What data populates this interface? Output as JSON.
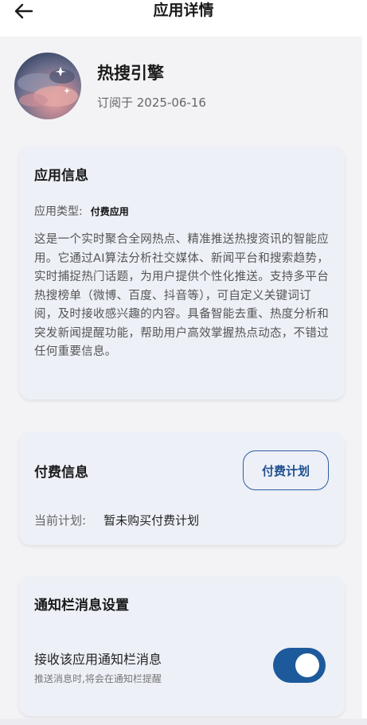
{
  "header": {
    "title": "应用详情"
  },
  "app": {
    "name": "热搜引擎",
    "subscribed": "订阅于 2025-06-16"
  },
  "info_card": {
    "title": "应用信息",
    "type_label": "应用类型:",
    "type_value": "付费应用",
    "description": "这是一个实时聚合全网热点、精准推送热搜资讯的智能应用。它通过AI算法分析社交媒体、新闻平台和搜索趋势，实时捕捉热门话题，为用户提供个性化推送。支持多平台热搜榜单（微博、百度、抖音等），可自定义关键词订阅，及时接收感兴趣的内容。具备智能去重、热度分析和突发新闻提醒功能，帮助用户高效掌握热点动态，不错过任何重要信息。"
  },
  "pay_card": {
    "title": "付费信息",
    "plan_button": "付费计划",
    "current_label": "当前计划:",
    "current_value": "暂未购买付费计划"
  },
  "notify_card": {
    "title": "通知栏消息设置",
    "toggle_label": "接收该应用通知栏消息",
    "toggle_hint": "推送消息时,将会在通知栏提醒",
    "toggle_on": true
  },
  "colors": {
    "accent": "#1d5a9b",
    "card_bg": "#edf0f7",
    "page_bg": "#f3f3f5"
  }
}
